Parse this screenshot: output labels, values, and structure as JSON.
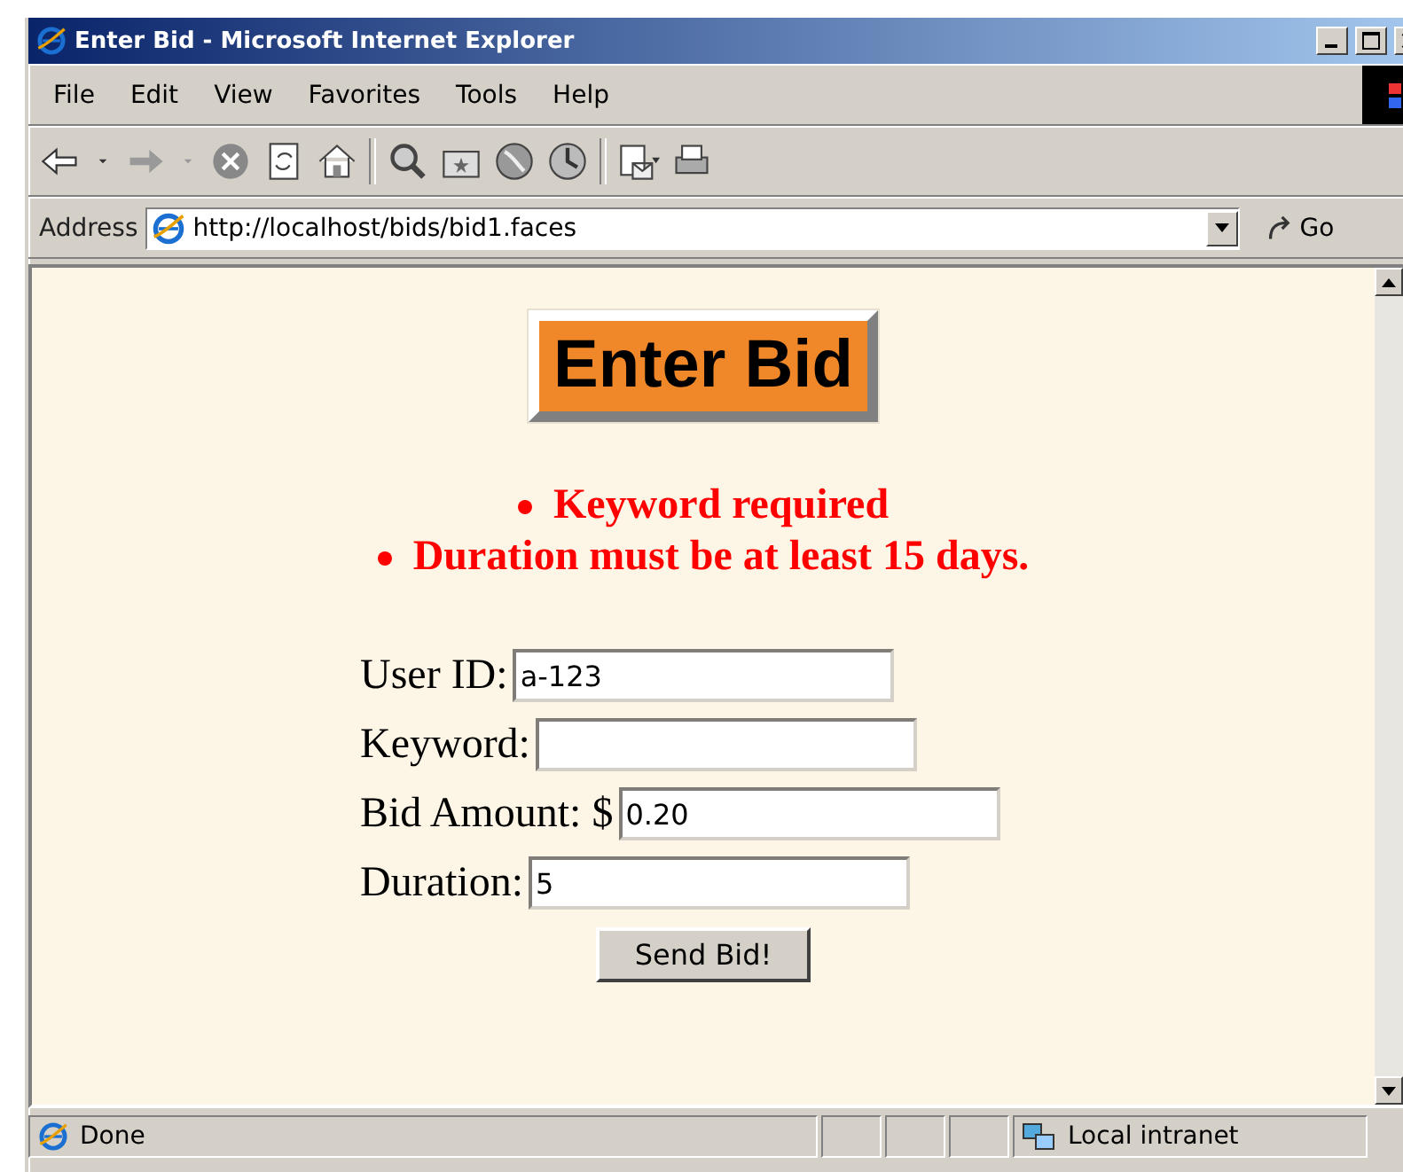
{
  "window": {
    "title": "Enter Bid - Microsoft Internet Explorer"
  },
  "menu": [
    "File",
    "Edit",
    "View",
    "Favorites",
    "Tools",
    "Help"
  ],
  "address_bar": {
    "label": "Address",
    "url": "http://localhost/bids/bid1.faces",
    "go": "Go"
  },
  "page": {
    "heading": "Enter Bid",
    "errors": [
      "Keyword required",
      "Duration must be at least 15 days."
    ],
    "fields": [
      {
        "label": "User ID:",
        "value": "a-123"
      },
      {
        "label": "Keyword:"
      },
      {
        "label": "Bid Amount: $",
        "value": "0.20"
      },
      {
        "label": "Duration:",
        "value": "5"
      }
    ],
    "submit": "Send Bid!"
  },
  "status_bar": {
    "text": "Done",
    "zone": "Local intranet"
  }
}
